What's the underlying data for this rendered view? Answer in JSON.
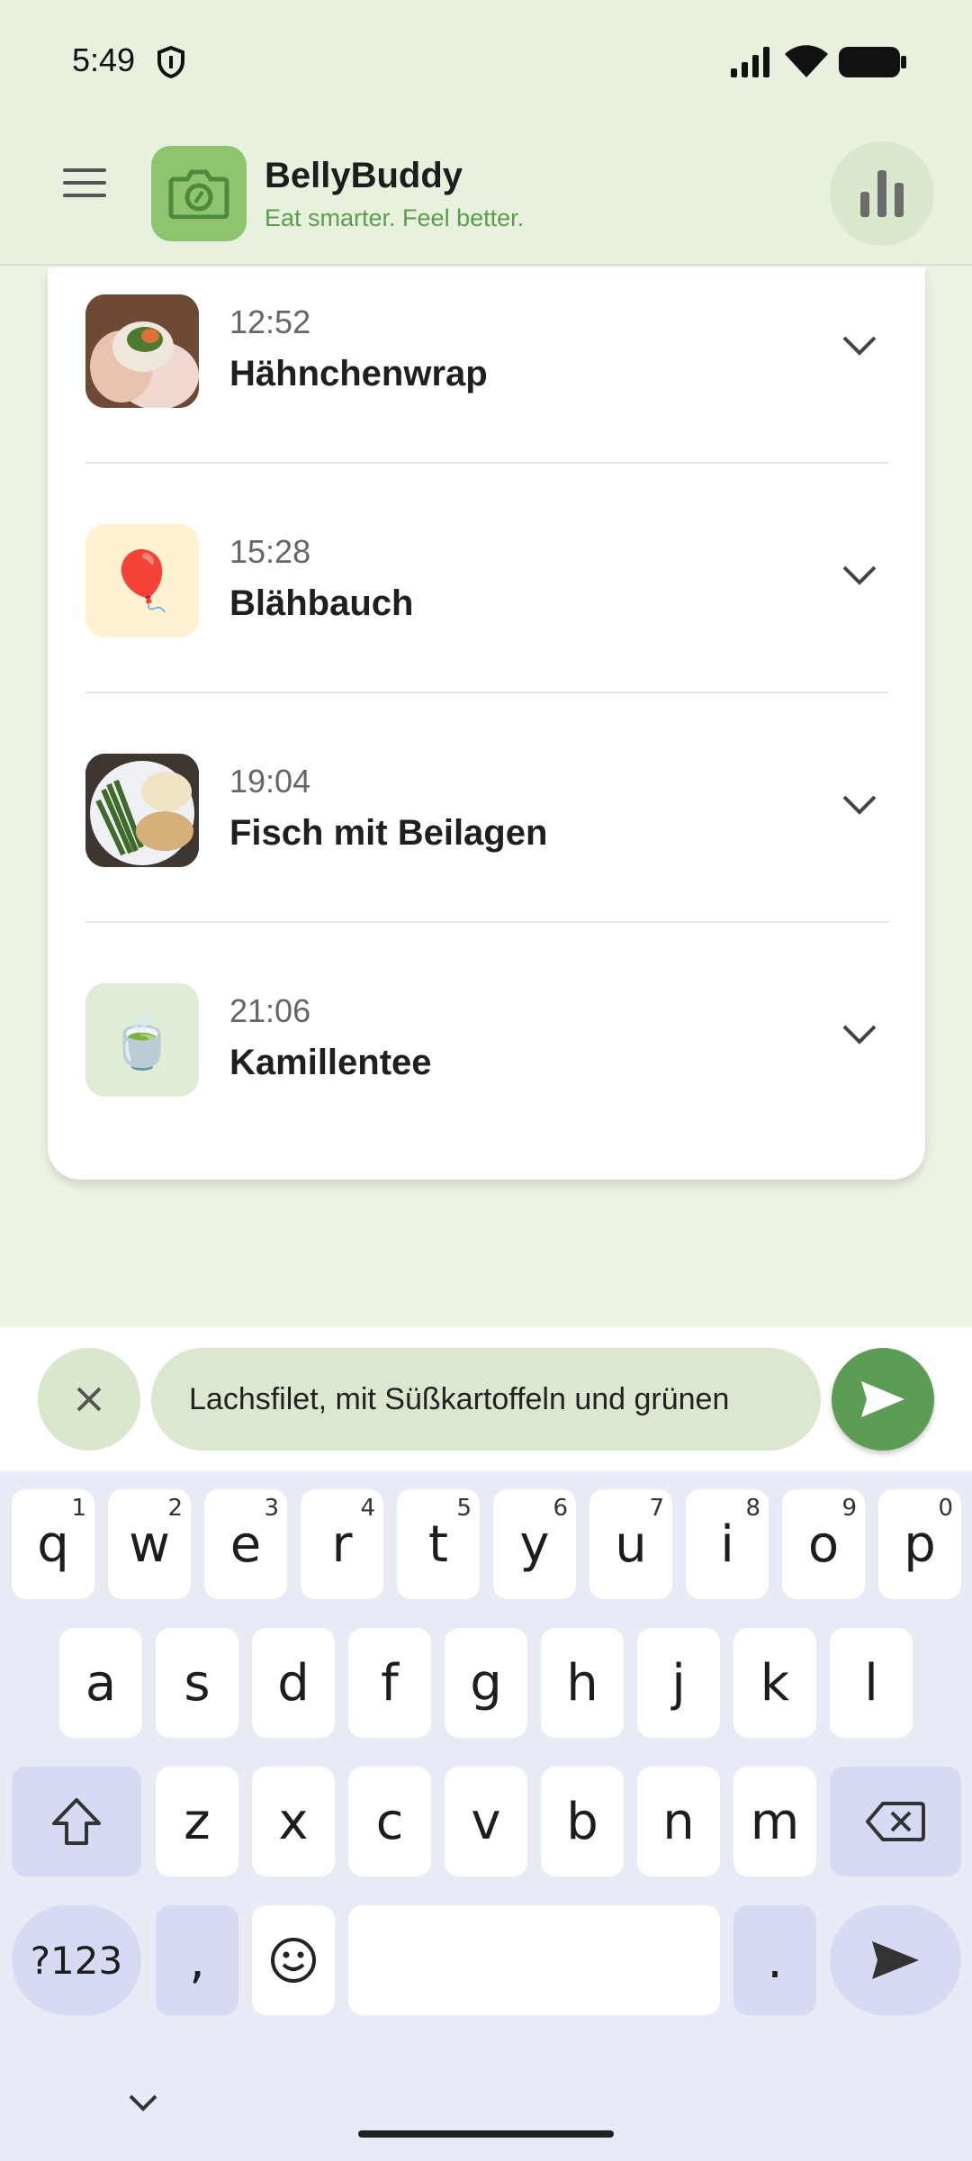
{
  "status_bar": {
    "time": "5:49"
  },
  "app": {
    "title": "BellyBuddy",
    "subtitle": "Eat smarter. Feel better."
  },
  "entries": [
    {
      "time": "12:52",
      "title": "Hähnchenwrap",
      "thumb": "food-photo-wrap"
    },
    {
      "time": "15:28",
      "title": "Blähbauch",
      "thumb": "balloon-emoji"
    },
    {
      "time": "19:04",
      "title": "Fisch mit Beilagen",
      "thumb": "food-photo-fish"
    },
    {
      "time": "21:06",
      "title": "Kamillentee",
      "thumb": "tea-emoji"
    }
  ],
  "emoji": {
    "balloon": "🎈",
    "tea": "🍵",
    "smiley": "☺"
  },
  "input": {
    "value": "Lachsfilet, mit Süßkartoffeln und grünen"
  },
  "keyboard": {
    "row1": [
      "q",
      "w",
      "e",
      "r",
      "t",
      "y",
      "u",
      "i",
      "o",
      "p"
    ],
    "row1_hints": [
      "1",
      "2",
      "3",
      "4",
      "5",
      "6",
      "7",
      "8",
      "9",
      "0"
    ],
    "row2": [
      "a",
      "s",
      "d",
      "f",
      "g",
      "h",
      "j",
      "k",
      "l"
    ],
    "row3": [
      "z",
      "x",
      "c",
      "v",
      "b",
      "n",
      "m"
    ],
    "symbols_key": "?123",
    "comma_key": ",",
    "period_key": "."
  },
  "colors": {
    "accent": "#5d9c54",
    "header_bg": "#e7f1de",
    "page_bg": "#ebf3e3"
  }
}
